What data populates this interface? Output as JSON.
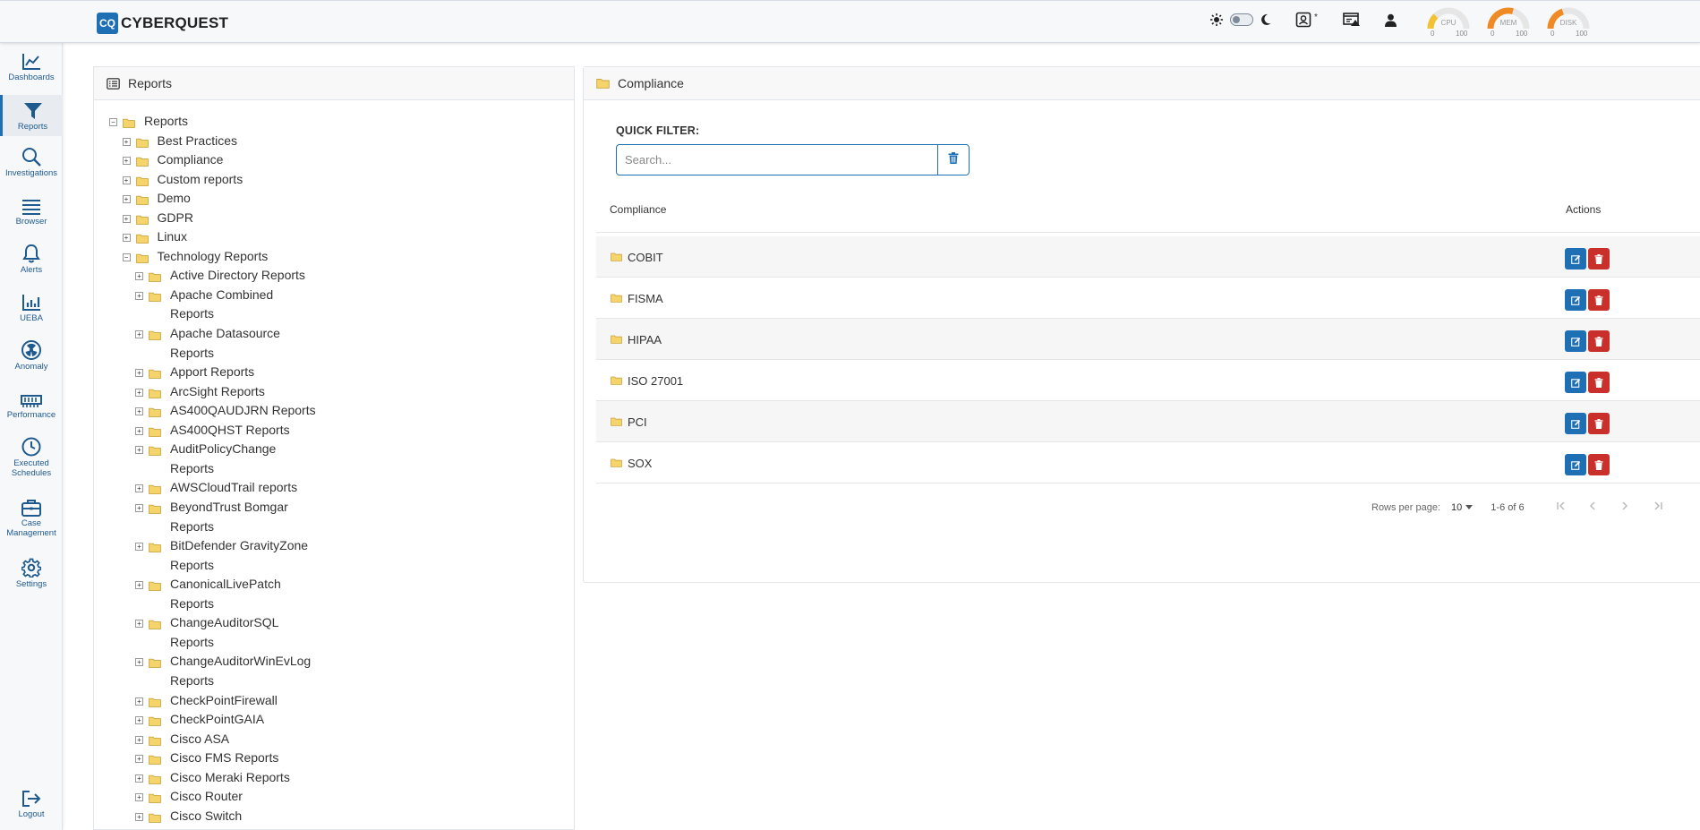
{
  "app": {
    "logo_mark": "CQ",
    "brand": "CYBERQUEST"
  },
  "topbar": {
    "icons": [
      "sun-icon",
      "theme-toggle",
      "moon-icon",
      "user-badge-icon",
      "window-alert-icon",
      "user-icon"
    ],
    "badge_star": "*",
    "gauges": [
      {
        "label": "CPU",
        "min": "0",
        "max": "100",
        "color": "#f2c233",
        "value": 0.2
      },
      {
        "label": "MEM",
        "min": "0",
        "max": "100",
        "color": "#f08a24",
        "value": 0.55
      },
      {
        "label": "DISK",
        "min": "0",
        "max": "100",
        "color": "#f08a24",
        "value": 0.4
      }
    ]
  },
  "nav": {
    "items": [
      {
        "label": "Dashboards",
        "icon": "chart-line-icon"
      },
      {
        "label": "Reports",
        "icon": "filter-icon",
        "active": true
      },
      {
        "label": "Investigations",
        "icon": "search-icon"
      },
      {
        "label": "Browser",
        "icon": "list-icon"
      },
      {
        "label": "Alerts",
        "icon": "bell-icon"
      },
      {
        "label": "UEBA",
        "icon": "bar-chart-icon"
      },
      {
        "label": "Anomaly",
        "icon": "radiation-icon"
      },
      {
        "label": "Performance",
        "icon": "memory-icon"
      },
      {
        "label": "Executed Schedules",
        "icon": "clock-icon"
      },
      {
        "label": "Case Management",
        "icon": "briefcase-icon"
      },
      {
        "label": "Settings",
        "icon": "gear-icon"
      }
    ],
    "logout": "Logout"
  },
  "reports_panel": {
    "title": "Reports",
    "tree": [
      {
        "label": "Reports",
        "level": 0,
        "expanded": true
      },
      {
        "label": "Best Practices",
        "level": 1
      },
      {
        "label": "Compliance",
        "level": 1
      },
      {
        "label": "Custom reports",
        "level": 1
      },
      {
        "label": "Demo",
        "level": 1
      },
      {
        "label": "GDPR",
        "level": 1
      },
      {
        "label": "Linux",
        "level": 1
      },
      {
        "label": "Technology Reports",
        "level": 1,
        "expanded": true
      },
      {
        "label": "Active Directory Reports",
        "level": 2
      },
      {
        "label": "Apache Combined Reports",
        "level": 2,
        "lines": [
          "Apache Combined",
          "Reports"
        ]
      },
      {
        "label": "Apache Datasource Reports",
        "level": 2,
        "lines": [
          "Apache Datasource",
          "Reports"
        ]
      },
      {
        "label": "Apport Reports",
        "level": 2
      },
      {
        "label": "ArcSight Reports",
        "level": 2
      },
      {
        "label": "AS400QAUDJRN Reports",
        "level": 2
      },
      {
        "label": "AS400QHST Reports",
        "level": 2
      },
      {
        "label": "AuditPolicyChange Reports",
        "level": 2,
        "lines": [
          "AuditPolicyChange",
          "Reports"
        ]
      },
      {
        "label": "AWSCloudTrail reports",
        "level": 2
      },
      {
        "label": "BeyondTrust Bomgar Reports",
        "level": 2,
        "lines": [
          "BeyondTrust Bomgar",
          "Reports"
        ]
      },
      {
        "label": "BitDefender GravityZone Reports",
        "level": 2,
        "lines": [
          "BitDefender GravityZone",
          "Reports"
        ]
      },
      {
        "label": "CanonicalLivePatch Reports",
        "level": 2,
        "lines": [
          "CanonicalLivePatch",
          "Reports"
        ]
      },
      {
        "label": "ChangeAuditorSQL Reports",
        "level": 2,
        "lines": [
          "ChangeAuditorSQL",
          "Reports"
        ]
      },
      {
        "label": "ChangeAuditorWinEvLog Reports",
        "level": 2,
        "lines": [
          "ChangeAuditorWinEvLog",
          "Reports"
        ]
      },
      {
        "label": "CheckPointFirewall",
        "level": 2
      },
      {
        "label": "CheckPointGAIA",
        "level": 2
      },
      {
        "label": "Cisco ASA",
        "level": 2
      },
      {
        "label": "Cisco FMS Reports",
        "level": 2
      },
      {
        "label": "Cisco Meraki Reports",
        "level": 2
      },
      {
        "label": "Cisco Router",
        "level": 2
      },
      {
        "label": "Cisco Switch",
        "level": 2
      }
    ]
  },
  "compliance_panel": {
    "title": "Compliance",
    "quick_filter_label": "QUICK FILTER:",
    "search_placeholder": "Search...",
    "columns": {
      "name": "Compliance",
      "actions": "Actions"
    },
    "rows": [
      "COBIT",
      "FISMA",
      "HIPAA",
      "ISO 27001",
      "PCI",
      "SOX"
    ],
    "pagination": {
      "rows_per_page_label": "Rows per page:",
      "rows_per_page": "10",
      "range": "1-6 of 6"
    }
  },
  "colors": {
    "accent": "#1f6fb5",
    "danger": "#c9302c",
    "folder": "#f5d46b"
  }
}
